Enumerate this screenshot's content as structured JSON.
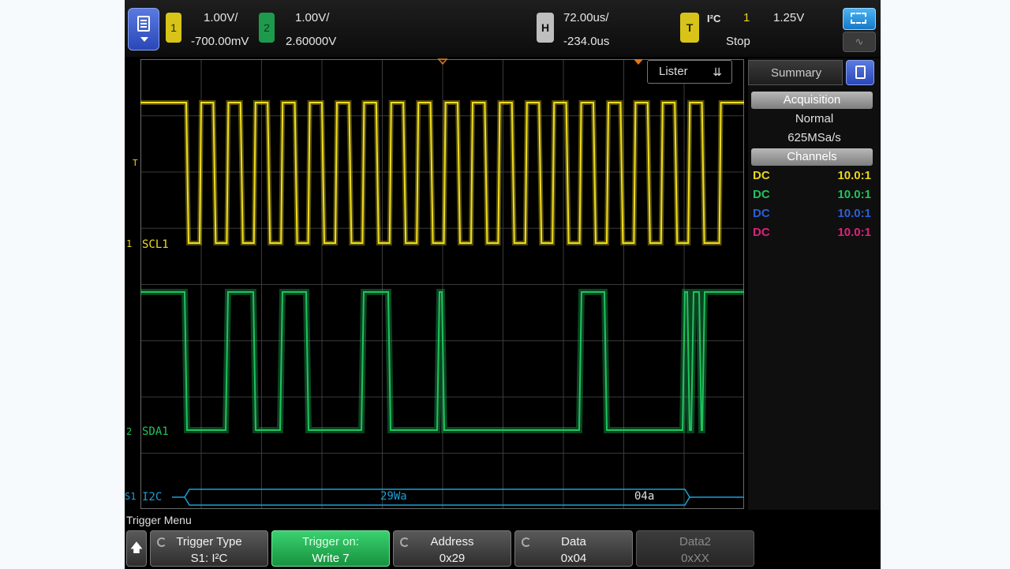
{
  "topbar": {
    "ch1": {
      "number": "1",
      "scale": "1.00V/",
      "offset": "-700.00mV",
      "color": "#e8d51e"
    },
    "ch2": {
      "number": "2",
      "scale": "1.00V/",
      "offset": "2.60000V",
      "color": "#1fb35a"
    },
    "horizontal": {
      "label": "H",
      "scale": "72.00us/",
      "delay": "-234.0us"
    },
    "trigger": {
      "label": "T",
      "type": "I²C",
      "source": "1",
      "level": "1.25V",
      "status": "Stop"
    },
    "menu_icon": "document-icon",
    "zoom_icon": "zoom-box-icon",
    "wave_icon": "waveform-icon"
  },
  "display": {
    "lister_label": "Lister",
    "trigger_marker": "T",
    "scl": {
      "marker": "1",
      "label": "SCL1",
      "color": "#f0de1c"
    },
    "sda": {
      "marker": "2",
      "label": "SDA1",
      "color": "#1fc45e"
    },
    "serial": {
      "marker": "S1",
      "label": "I2C",
      "color": "#1aa0d8",
      "packets": [
        {
          "text": "29Wa"
        },
        {
          "text": "04a"
        }
      ]
    }
  },
  "panel": {
    "tab": "Summary",
    "acquisition": {
      "header": "Acquisition",
      "mode": "Normal",
      "rate": "625MSa/s"
    },
    "channels": {
      "header": "Channels",
      "rows": [
        {
          "coupling": "DC",
          "probe": "10.0:1",
          "color": "#e8d51e"
        },
        {
          "coupling": "DC",
          "probe": "10.0:1",
          "color": "#1fc45e"
        },
        {
          "coupling": "DC",
          "probe": "10.0:1",
          "color": "#2a5fd8"
        },
        {
          "coupling": "DC",
          "probe": "10.0:1",
          "color": "#e0207a"
        }
      ]
    }
  },
  "softkeys": {
    "menu_title": "Trigger Menu",
    "up_icon": "up-arrow-icon",
    "keys": [
      {
        "line1": "Trigger Type",
        "line2": "S1: I²C"
      },
      {
        "line1": "Trigger on:",
        "line2": "Write 7"
      },
      {
        "line1": "Address",
        "line2": "0x29"
      },
      {
        "line1": "Data",
        "line2": "0x04"
      },
      {
        "line1": "Data2",
        "line2": "0xXX"
      }
    ]
  }
}
